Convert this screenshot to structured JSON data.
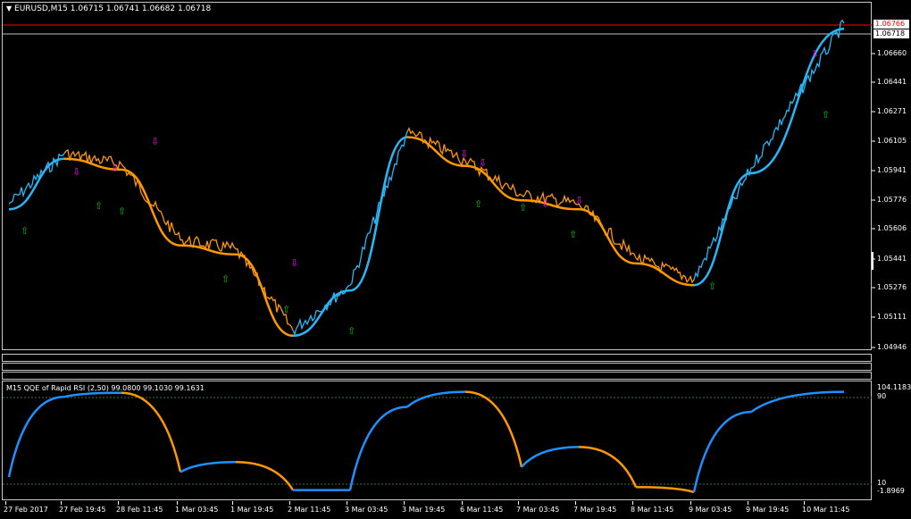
{
  "header": {
    "symbol": "EURUSD,M15",
    "ohlc": "1.06715 1.06741 1.06682 1.06718",
    "menu_icon": "triangle-down-icon"
  },
  "indicator": {
    "title": "M15 QQE of Rapid RSI (2,50) 99.0800 99.1030 99.1631",
    "labels": [
      "104.1183",
      "90",
      "10",
      "-1.8969"
    ]
  },
  "price_axis": {
    "labels": [
      "1.06660",
      "1.06441",
      "1.06271",
      "1.06105",
      "1.05941",
      "1.05776",
      "1.05606",
      "1.05441",
      "1.05276",
      "1.05111",
      "1.04946"
    ],
    "ask_tag": "1.06766",
    "bid_tag": "1.06718"
  },
  "time_axis": {
    "labels": [
      "27 Feb 2017",
      "27 Feb 19:45",
      "28 Feb 11:45",
      "1 Mar 03:45",
      "1 Mar 19:45",
      "2 Mar 11:45",
      "3 Mar 03:45",
      "3 Mar 19:45",
      "6 Mar 11:45",
      "7 Mar 03:45",
      "7 Mar 19:45",
      "8 Mar 11:45",
      "9 Mar 03:45",
      "9 Mar 19:45",
      "10 Mar 11:45"
    ]
  },
  "colors": {
    "background": "#000000",
    "bull": "#1e90ff",
    "price_bull": "#29b6f6",
    "bear": "#ff9800",
    "ask_line": "#ff0000",
    "bid_line": "#c0c0c0",
    "up_arrow": "#00c000",
    "down_arrow": "#ff00ff",
    "level_line": "#2e7d32"
  },
  "chart_data": [
    {
      "type": "line",
      "title": "EURUSD,M15",
      "x": [
        "27 Feb 2017",
        "27 Feb 19:45",
        "28 Feb 11:45",
        "1 Mar 03:45",
        "1 Mar 19:45",
        "2 Mar 11:45",
        "3 Mar 03:45",
        "3 Mar 19:45",
        "6 Mar 11:45",
        "7 Mar 03:45",
        "7 Mar 19:45",
        "8 Mar 11:45",
        "9 Mar 03:45",
        "9 Mar 19:45",
        "10 Mar 11:45"
      ],
      "series": [
        {
          "values": [
            1.057,
            1.0598,
            1.0592,
            1.055,
            1.0545,
            1.05,
            1.0525,
            1.061,
            1.0594,
            1.0575,
            1.057,
            1.054,
            1.0528,
            1.059,
            1.067
          ]
        }
      ],
      "ylim": [
        1.049,
        1.068
      ]
    },
    {
      "type": "line",
      "title": "M15 QQE of Rapid RSI (2,50)",
      "x": [
        "27 Feb 2017",
        "27 Feb 19:45",
        "28 Feb 11:45",
        "1 Mar 03:45",
        "1 Mar 19:45",
        "2 Mar 11:45",
        "3 Mar 03:45",
        "3 Mar 19:45",
        "6 Mar 11:45",
        "7 Mar 03:45",
        "7 Mar 19:45",
        "8 Mar 11:45",
        "9 Mar 03:45",
        "9 Mar 19:45",
        "10 Mar 11:45"
      ],
      "series": [
        {
          "values": [
            15,
            95,
            99,
            20,
            30,
            2,
            2,
            85,
            100,
            25,
            45,
            5,
            0,
            80,
            100
          ]
        }
      ],
      "ylim": [
        -1.8969,
        104.1183
      ],
      "levels": [
        90,
        10
      ]
    }
  ]
}
